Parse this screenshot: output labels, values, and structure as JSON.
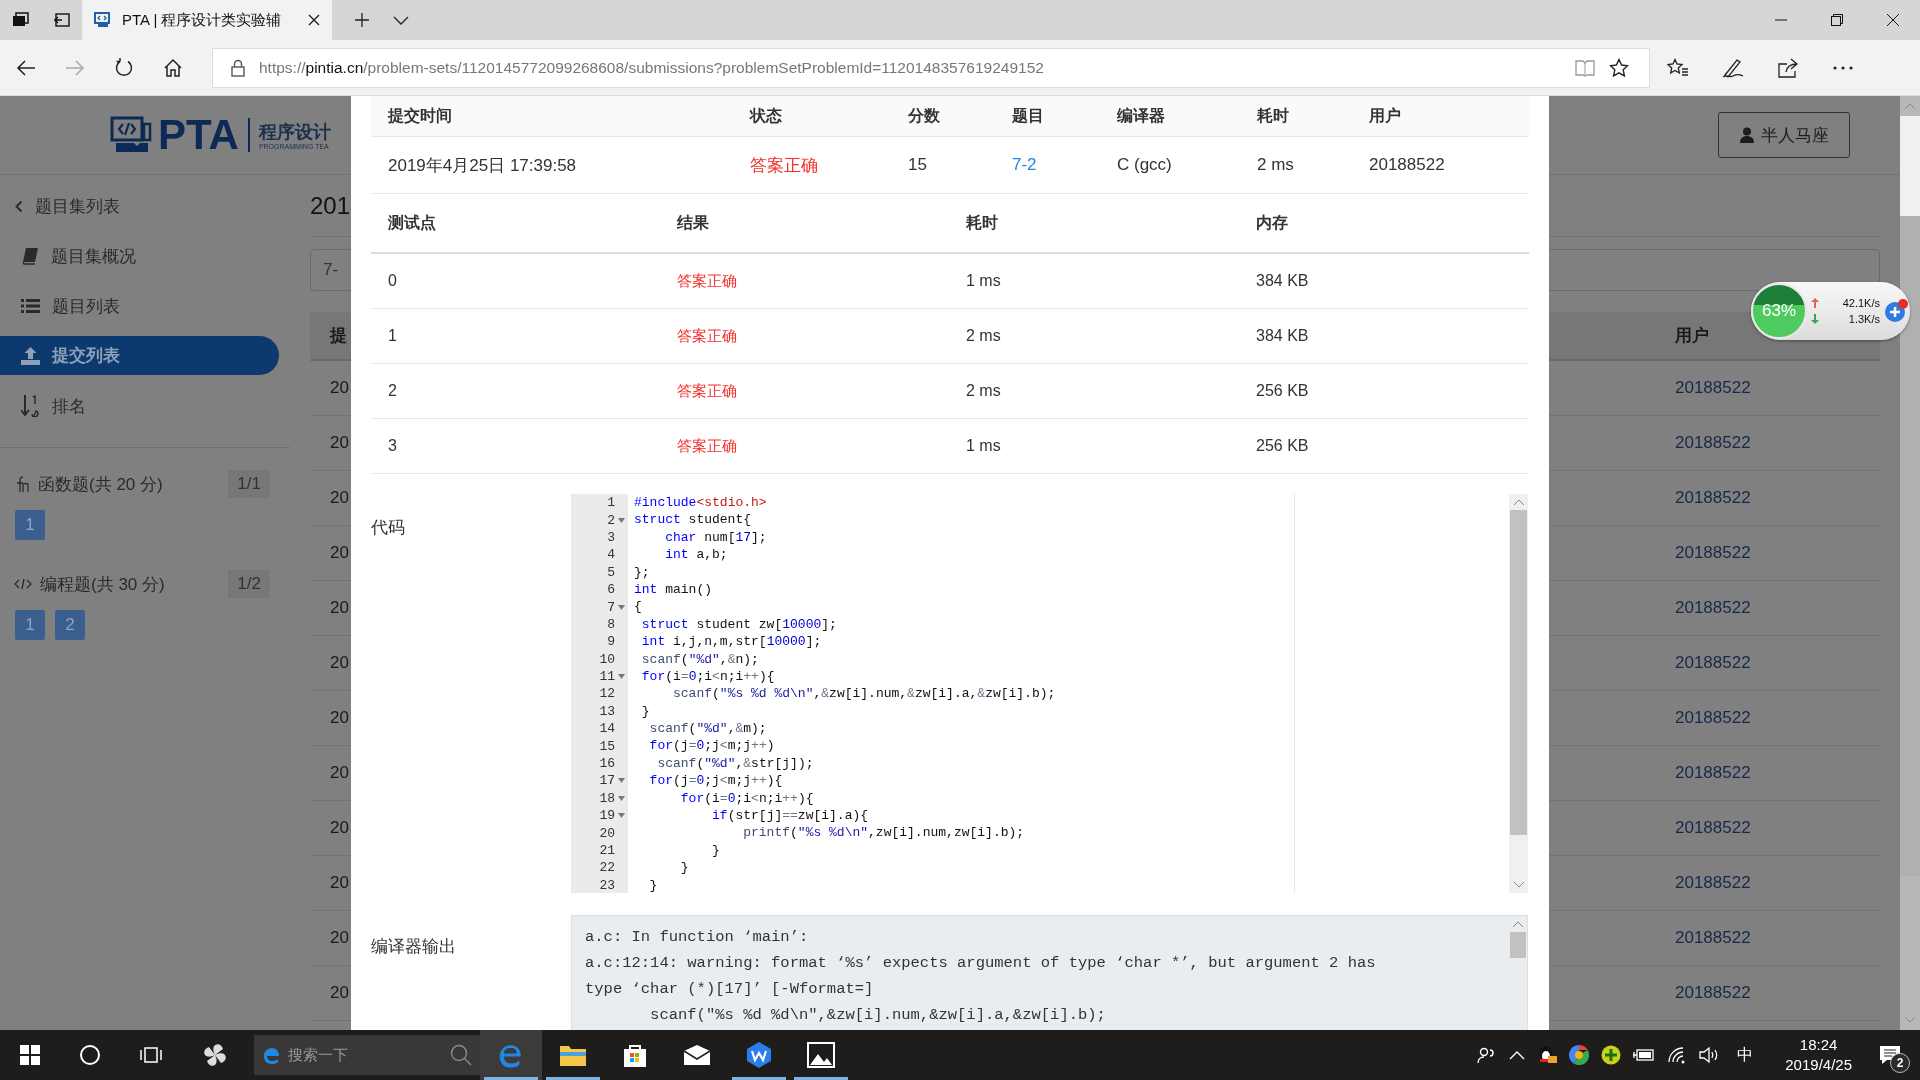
{
  "browser": {
    "tabs": [
      {
        "title": "PTA | 程序设计类实验辅",
        "selected": true
      }
    ],
    "forward_disabled": true,
    "url": {
      "scheme": "https://",
      "host": "pintia.cn",
      "path": "/problem-sets/1120145772099268608/submissions?problemSetProblemId=1120148357619249152"
    }
  },
  "site": {
    "logo": "PTA",
    "logo_subtitle": "程序设计",
    "logo_tagline": "PROGRAMMING TEA",
    "user_button": "半人马座"
  },
  "sidebar": {
    "back_link": "题目集列表",
    "items": [
      {
        "label": "题目集概况",
        "selected": false
      },
      {
        "label": "题目列表",
        "selected": false
      },
      {
        "label": "提交列表",
        "selected": true
      },
      {
        "label": "排名",
        "selected": false
      }
    ],
    "groups": [
      {
        "title": "函数题(共 20 分)",
        "progress": "1/1",
        "problems": [
          "1"
        ]
      },
      {
        "title": "编程题(共 30 分)",
        "progress": "1/2",
        "problems": [
          "1",
          "2"
        ]
      }
    ]
  },
  "background_list": {
    "title": "201",
    "filter": "7-",
    "header_first": "提",
    "header_user": "用户",
    "rows": [
      {
        "column_1": "20",
        "user": "20188522"
      },
      {
        "column_1": "20",
        "user": "20188522"
      },
      {
        "column_1": "20",
        "user": "20188522"
      },
      {
        "column_1": "20",
        "user": "20188522"
      },
      {
        "column_1": "20",
        "user": "20188522"
      },
      {
        "column_1": "20",
        "user": "20188522"
      },
      {
        "column_1": "20",
        "user": "20188522"
      },
      {
        "column_1": "20",
        "user": "20188522"
      },
      {
        "column_1": "20",
        "user": "20188522"
      },
      {
        "column_1": "20",
        "user": "20188522"
      },
      {
        "column_1": "20",
        "user": "20188522"
      },
      {
        "column_1": "20",
        "user": "20188522"
      }
    ]
  },
  "dialog": {
    "submission": {
      "columns": [
        "提交时间",
        "状态",
        "分数",
        "题目",
        "编译器",
        "耗时",
        "用户"
      ],
      "row": [
        {
          "text": "2019年4月25日 17:39:58",
          "kind": "text"
        },
        {
          "text": "答案正确",
          "kind": "status"
        },
        {
          "text": "15",
          "kind": "text"
        },
        {
          "text": "7-2",
          "kind": "link"
        },
        {
          "text": "C (gcc)",
          "kind": "text"
        },
        {
          "text": "2 ms",
          "kind": "text"
        },
        {
          "text": "20188522",
          "kind": "text"
        }
      ]
    },
    "testcases": {
      "columns": [
        "测试点",
        "结果",
        "耗时",
        "内存"
      ],
      "rows": [
        [
          {
            "text": "0",
            "kind": "text"
          },
          {
            "text": "答案正确",
            "kind": "status"
          },
          {
            "text": "1 ms",
            "kind": "text"
          },
          {
            "text": "384 KB",
            "kind": "text"
          }
        ],
        [
          {
            "text": "1",
            "kind": "text"
          },
          {
            "text": "答案正确",
            "kind": "status"
          },
          {
            "text": "2 ms",
            "kind": "text"
          },
          {
            "text": "384 KB",
            "kind": "text"
          }
        ],
        [
          {
            "text": "2",
            "kind": "text"
          },
          {
            "text": "答案正确",
            "kind": "status"
          },
          {
            "text": "2 ms",
            "kind": "text"
          },
          {
            "text": "256 KB",
            "kind": "text"
          }
        ],
        [
          {
            "text": "3",
            "kind": "text"
          },
          {
            "text": "答案正确",
            "kind": "status"
          },
          {
            "text": "1 ms",
            "kind": "text"
          },
          {
            "text": "256 KB",
            "kind": "text"
          }
        ]
      ]
    },
    "code": {
      "label": "代码",
      "lines": [
        {
          "number": "1",
          "foldable": false,
          "tokens": [
            {
              "text": "#include",
              "kind": "kw"
            },
            {
              "text": "<stdio.h>",
              "kind": "hdr"
            }
          ]
        },
        {
          "number": "2",
          "foldable": true,
          "tokens": [
            {
              "text": "struct",
              "kind": "kw"
            },
            {
              "text": " student{",
              "kind": "txt"
            }
          ]
        },
        {
          "number": "3",
          "foldable": false,
          "tokens": [
            {
              "text": "    char",
              "kind": "kw"
            },
            {
              "text": " num[",
              "kind": "txt"
            },
            {
              "text": "17",
              "kind": "num"
            },
            {
              "text": "];",
              "kind": "txt"
            }
          ]
        },
        {
          "number": "4",
          "foldable": false,
          "tokens": [
            {
              "text": "    int",
              "kind": "kw"
            },
            {
              "text": " a,b;",
              "kind": "txt"
            }
          ]
        },
        {
          "number": "5",
          "foldable": false,
          "tokens": [
            {
              "text": "};",
              "kind": "txt"
            }
          ]
        },
        {
          "number": "6",
          "foldable": false,
          "tokens": [
            {
              "text": "int",
              "kind": "kw"
            },
            {
              "text": " main()",
              "kind": "txt"
            }
          ]
        },
        {
          "number": "7",
          "foldable": true,
          "tokens": [
            {
              "text": "{",
              "kind": "txt"
            }
          ]
        },
        {
          "number": "8",
          "foldable": false,
          "tokens": [
            {
              "text": " struct",
              "kind": "kw"
            },
            {
              "text": " student zw[",
              "kind": "txt"
            },
            {
              "text": "10000",
              "kind": "num"
            },
            {
              "text": "];",
              "kind": "txt"
            }
          ]
        },
        {
          "number": "9",
          "foldable": false,
          "tokens": [
            {
              "text": " int",
              "kind": "kw"
            },
            {
              "text": " i,j,n,m,str[",
              "kind": "txt"
            },
            {
              "text": "10000",
              "kind": "num"
            },
            {
              "text": "];",
              "kind": "txt"
            }
          ]
        },
        {
          "number": "10",
          "foldable": false,
          "tokens": [
            {
              "text": " scanf",
              "kind": "fn"
            },
            {
              "text": "(",
              "kind": "txt"
            },
            {
              "text": "\"%d\"",
              "kind": "str"
            },
            {
              "text": ",",
              "kind": "txt"
            },
            {
              "text": "&",
              "kind": "op"
            },
            {
              "text": "n);",
              "kind": "txt"
            }
          ]
        },
        {
          "number": "11",
          "foldable": true,
          "tokens": [
            {
              "text": " for",
              "kind": "kw"
            },
            {
              "text": "(i",
              "kind": "txt"
            },
            {
              "text": "=",
              "kind": "op"
            },
            {
              "text": "0",
              "kind": "num"
            },
            {
              "text": ";i",
              "kind": "txt"
            },
            {
              "text": "<",
              "kind": "op"
            },
            {
              "text": "n;i",
              "kind": "txt"
            },
            {
              "text": "++",
              "kind": "op"
            },
            {
              "text": "){",
              "kind": "txt"
            }
          ]
        },
        {
          "number": "12",
          "foldable": false,
          "tokens": [
            {
              "text": "     scanf",
              "kind": "fn"
            },
            {
              "text": "(",
              "kind": "txt"
            },
            {
              "text": "\"%s %d %d\\n\"",
              "kind": "str"
            },
            {
              "text": ",",
              "kind": "txt"
            },
            {
              "text": "&",
              "kind": "op"
            },
            {
              "text": "zw[i].num,",
              "kind": "txt"
            },
            {
              "text": "&",
              "kind": "op"
            },
            {
              "text": "zw[i].a,",
              "kind": "txt"
            },
            {
              "text": "&",
              "kind": "op"
            },
            {
              "text": "zw[i].b);",
              "kind": "txt"
            }
          ]
        },
        {
          "number": "13",
          "foldable": false,
          "tokens": [
            {
              "text": " }",
              "kind": "txt"
            }
          ]
        },
        {
          "number": "14",
          "foldable": false,
          "tokens": [
            {
              "text": "  scanf",
              "kind": "fn"
            },
            {
              "text": "(",
              "kind": "txt"
            },
            {
              "text": "\"%d\"",
              "kind": "str"
            },
            {
              "text": ",",
              "kind": "txt"
            },
            {
              "text": "&",
              "kind": "op"
            },
            {
              "text": "m);",
              "kind": "txt"
            }
          ]
        },
        {
          "number": "15",
          "foldable": false,
          "tokens": [
            {
              "text": "  for",
              "kind": "kw"
            },
            {
              "text": "(j",
              "kind": "txt"
            },
            {
              "text": "=",
              "kind": "op"
            },
            {
              "text": "0",
              "kind": "num"
            },
            {
              "text": ";j",
              "kind": "txt"
            },
            {
              "text": "<",
              "kind": "op"
            },
            {
              "text": "m;j",
              "kind": "txt"
            },
            {
              "text": "++",
              "kind": "op"
            },
            {
              "text": ")",
              "kind": "txt"
            }
          ]
        },
        {
          "number": "16",
          "foldable": false,
          "tokens": [
            {
              "text": "   scanf",
              "kind": "fn"
            },
            {
              "text": "(",
              "kind": "txt"
            },
            {
              "text": "\"%d\"",
              "kind": "str"
            },
            {
              "text": ",",
              "kind": "txt"
            },
            {
              "text": "&",
              "kind": "op"
            },
            {
              "text": "str[j]);",
              "kind": "txt"
            }
          ]
        },
        {
          "number": "17",
          "foldable": true,
          "tokens": [
            {
              "text": "  for",
              "kind": "kw"
            },
            {
              "text": "(j",
              "kind": "txt"
            },
            {
              "text": "=",
              "kind": "op"
            },
            {
              "text": "0",
              "kind": "num"
            },
            {
              "text": ";j",
              "kind": "txt"
            },
            {
              "text": "<",
              "kind": "op"
            },
            {
              "text": "m;j",
              "kind": "txt"
            },
            {
              "text": "++",
              "kind": "op"
            },
            {
              "text": "){",
              "kind": "txt"
            }
          ]
        },
        {
          "number": "18",
          "foldable": true,
          "tokens": [
            {
              "text": "      for",
              "kind": "kw"
            },
            {
              "text": "(i",
              "kind": "txt"
            },
            {
              "text": "=",
              "kind": "op"
            },
            {
              "text": "0",
              "kind": "num"
            },
            {
              "text": ";i",
              "kind": "txt"
            },
            {
              "text": "<",
              "kind": "op"
            },
            {
              "text": "n;i",
              "kind": "txt"
            },
            {
              "text": "++",
              "kind": "op"
            },
            {
              "text": "){",
              "kind": "txt"
            }
          ]
        },
        {
          "number": "19",
          "foldable": true,
          "tokens": [
            {
              "text": "          if",
              "kind": "kw"
            },
            {
              "text": "(str[j]",
              "kind": "txt"
            },
            {
              "text": "==",
              "kind": "op"
            },
            {
              "text": "zw[i].a){",
              "kind": "txt"
            }
          ]
        },
        {
          "number": "20",
          "foldable": false,
          "tokens": [
            {
              "text": "              printf",
              "kind": "fn"
            },
            {
              "text": "(",
              "kind": "txt"
            },
            {
              "text": "\"%s %d\\n\"",
              "kind": "str"
            },
            {
              "text": ",zw[i].num,zw[i].b);",
              "kind": "txt"
            }
          ]
        },
        {
          "number": "21",
          "foldable": false,
          "tokens": [
            {
              "text": "          }",
              "kind": "txt"
            }
          ]
        },
        {
          "number": "22",
          "foldable": false,
          "tokens": [
            {
              "text": "      }",
              "kind": "txt"
            }
          ]
        },
        {
          "number": "23",
          "foldable": false,
          "tokens": [
            {
              "text": "  }",
              "kind": "txt"
            }
          ]
        }
      ]
    },
    "compiler_output": {
      "label": "编译器输出",
      "lines": [
        "a.c: In function ‘main’:",
        "a.c:12:14: warning: format ‘%s’ expects argument of type ‘char *’, but argument 2 has",
        "type ‘char (*)[17]’ [-Wformat=]",
        "       scanf(\"%s %d %d\\n\",&zw[i].num,&zw[i].a,&zw[i].b);"
      ]
    }
  },
  "network_widget": {
    "percent": "63%",
    "upload": "42.1K/s",
    "download": "1.3K/s"
  },
  "taskbar": {
    "search_placeholder": "搜索一下",
    "apps": [
      {
        "running": true,
        "selected": true
      },
      {
        "running": true,
        "selected": false
      },
      {
        "running": false,
        "selected": false
      },
      {
        "running": false,
        "selected": false
      },
      {
        "running": true,
        "selected": false
      },
      {
        "running": true,
        "selected": false
      }
    ],
    "ime": "中",
    "time": "18:24",
    "date": "2019/4/25",
    "notifications": "2"
  }
}
